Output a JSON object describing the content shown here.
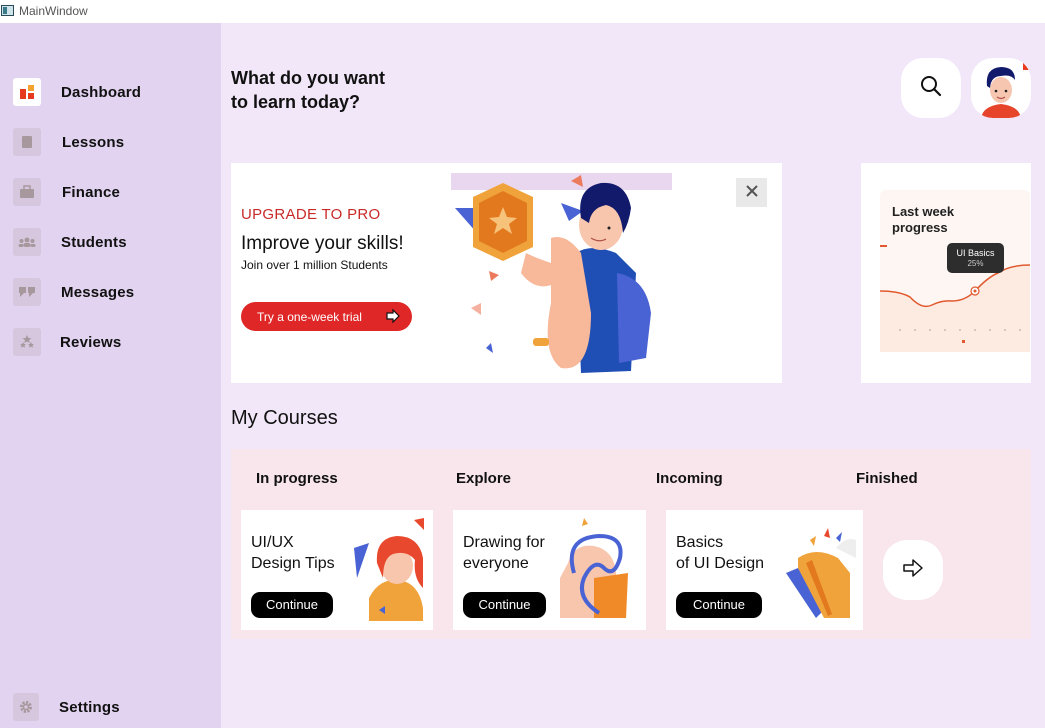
{
  "window": {
    "title": "MainWindow"
  },
  "sidebar": {
    "items": [
      {
        "label": "Dashboard",
        "icon": "dashboard-icon"
      },
      {
        "label": "Lessons",
        "icon": "book-icon"
      },
      {
        "label": "Finance",
        "icon": "briefcase-icon"
      },
      {
        "label": "Students",
        "icon": "users-icon"
      },
      {
        "label": "Messages",
        "icon": "quote-icon"
      },
      {
        "label": "Reviews",
        "icon": "stars-icon"
      }
    ],
    "settings": {
      "label": "Settings",
      "icon": "gear-icon"
    }
  },
  "header": {
    "title_line1": "What do you want",
    "title_line2": "to learn today?",
    "search_icon": "search-icon",
    "avatar_icon": "avatar"
  },
  "promo": {
    "label": "UPGRADE TO PRO",
    "title": "Improve your skills!",
    "subtitle": "Join over 1 million Students",
    "button": "Try a one-week trial",
    "close_icon": "close-icon"
  },
  "progress_card": {
    "title_line1": "Last week",
    "title_line2": "progress",
    "tooltip_title": "UI Basics",
    "tooltip_value": "25%"
  },
  "courses": {
    "title": "My Courses",
    "tabs": [
      "In progress",
      "Explore",
      "Incoming",
      "Finished"
    ],
    "cards": [
      {
        "line1": "UI/UX",
        "line2": "Design Tips",
        "button": "Continue"
      },
      {
        "line1": "Drawing for",
        "line2": "everyone",
        "button": "Continue"
      },
      {
        "line1": "Basics",
        "line2": "of UI Design",
        "button": "Continue"
      }
    ],
    "next_icon": "arrow-right-icon"
  },
  "colors": {
    "sidebar_bg": "#e2d3f0",
    "page_bg": "#f2e7f8",
    "accent_red": "#e02727",
    "courses_bg": "#f8e6ec",
    "button_black": "#000000"
  }
}
